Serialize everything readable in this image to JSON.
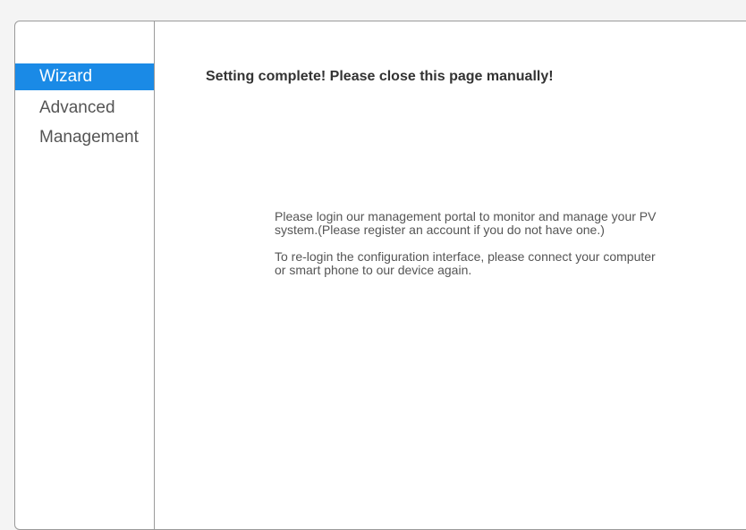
{
  "sidebar": {
    "items": [
      {
        "label": "Wizard",
        "active": true
      },
      {
        "label": "Advanced",
        "active": false
      },
      {
        "label": "Management",
        "active": false
      }
    ]
  },
  "main": {
    "heading": "Setting complete! Please close this page manually!",
    "paragraph1": "Please login our management portal to monitor and manage your PV system.(Please register an account if you do not have one.)",
    "paragraph2": "To re-login the configuration interface, please connect your computer or smart phone to our device again."
  },
  "colors": {
    "accent": "#1a8ae6",
    "text": "#555555",
    "heading": "#333333",
    "border": "#9a9a9a"
  }
}
